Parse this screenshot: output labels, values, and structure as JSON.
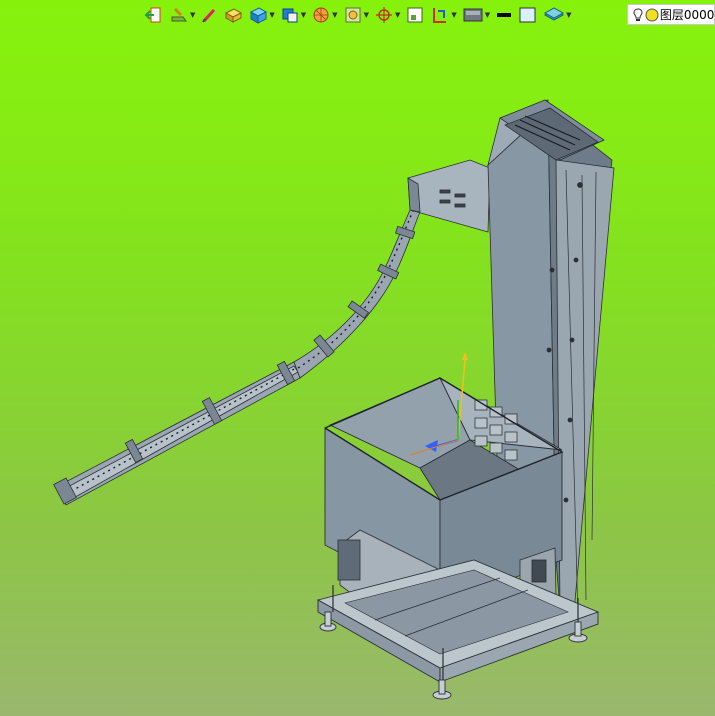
{
  "toolbar": {
    "buttons": [
      {
        "name": "exit-sketch-icon"
      },
      {
        "name": "sketch-icon"
      },
      {
        "name": "pen-icon"
      },
      {
        "name": "box-feature-icon"
      },
      {
        "name": "solid-icon"
      },
      {
        "name": "boolean-icon"
      },
      {
        "name": "sphere-icon"
      },
      {
        "name": "view-icon"
      },
      {
        "name": "target-icon"
      },
      {
        "name": "frame-icon"
      },
      {
        "name": "section-icon"
      },
      {
        "name": "display-icon"
      },
      {
        "name": "line-color-icon"
      },
      {
        "name": "fill-color-icon"
      },
      {
        "name": "layers-icon"
      }
    ],
    "colors": {
      "black_swatch": "#000000",
      "fill_swatch": "#d8f0f8"
    }
  },
  "layer": {
    "label": "图层0000",
    "bulb_icon": "bulb-icon",
    "dot_icon": "layer-color-dot-icon"
  },
  "scene": {
    "background_top": "#86f20c",
    "background_bottom": "#9ab86d",
    "model_color": "#8495a3"
  }
}
